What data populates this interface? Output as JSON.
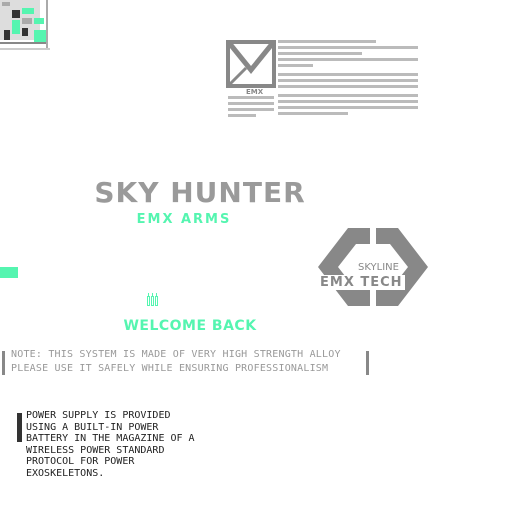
{
  "brand": {
    "title": "SKY HUNTER",
    "subtitle": "EMX ARMS",
    "logo_top_label": "SKYLINE",
    "logo_main_label": "EMX TECH",
    "envelope_caption": "EMX"
  },
  "welcome": "WELCOME BACK",
  "note": {
    "line1": "NOTE: THIS SYSTEM IS MADE OF VERY HIGH STRENGTH ALLOY",
    "line2": "PLEASE USE IT SAFELY WHILE ENSURING PROFESSIONALISM"
  },
  "power_text": "POWER SUPPLY IS PROVIDED USING A BUILT-IN POWER BATTERY IN THE MAGAZINE OF A WIRELESS POWER STANDARD PROTOCOL FOR POWER EXOSKELETONS.",
  "colors": {
    "accent": "#55f5b0",
    "gray": "#999999",
    "dark": "#222222"
  },
  "icons": [
    "pixel-grid-icon",
    "envelope-icon",
    "cartridges-icon",
    "hex-bracket-logo"
  ]
}
